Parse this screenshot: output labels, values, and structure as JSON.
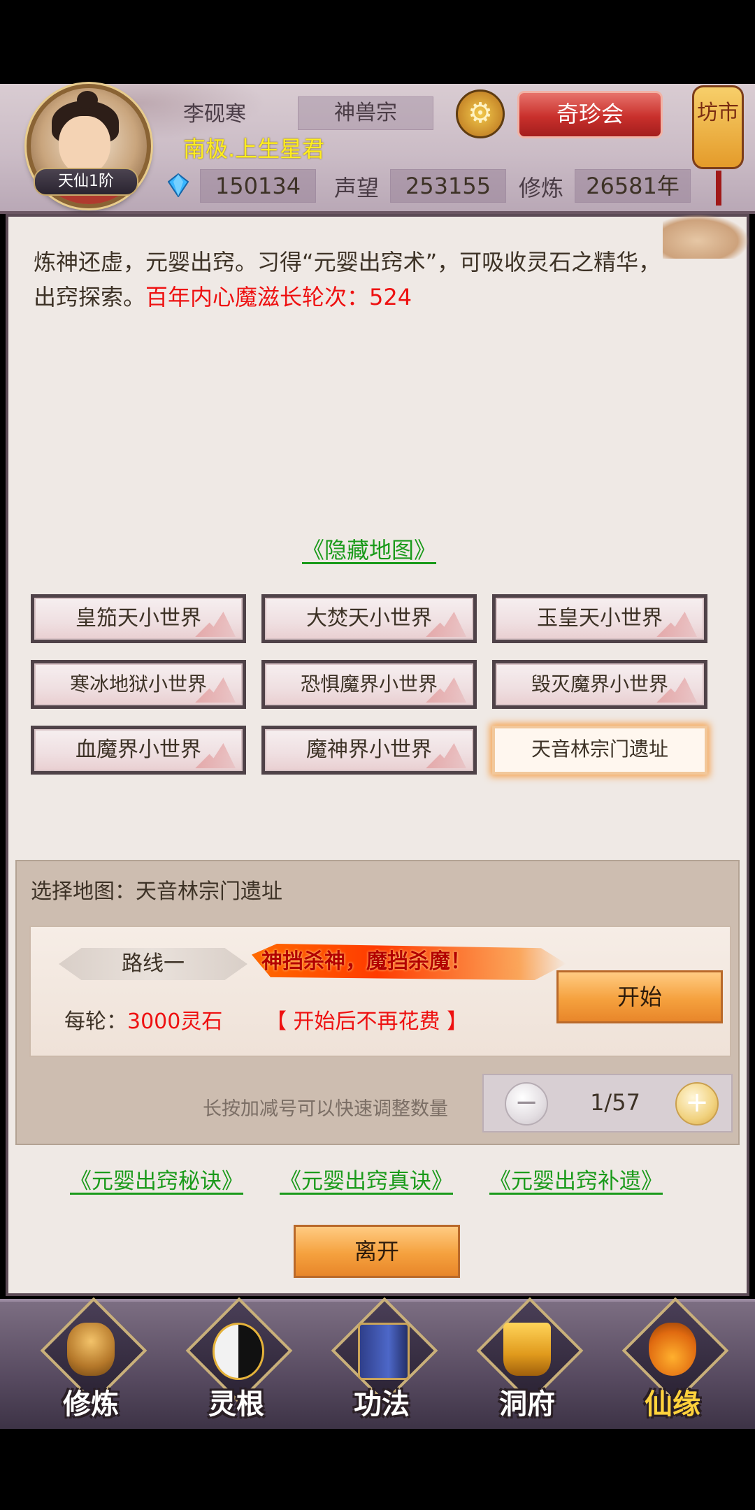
{
  "header": {
    "player_name": "李砚寒",
    "player_title": "南极.上生星君",
    "level": "天仙1阶",
    "sect": "神兽宗",
    "treasure_button": "奇珍会",
    "market_lantern": "坊市",
    "spirit_stones": "150134",
    "reputation_label": "声望",
    "reputation": "253155",
    "cultivation_label": "修炼",
    "cultivation": "26581年"
  },
  "main": {
    "description": "炼神还虚，元婴出窍。习得“元婴出窍术”，可吸收灵石之精华，出窍探索。",
    "description_highlight": "百年内心魔滋长轮次：524",
    "hidden_map_link": "《隐藏地图》",
    "maps": [
      {
        "label": "皇笳天小世界",
        "selected": false
      },
      {
        "label": "大焚天小世界",
        "selected": false
      },
      {
        "label": "玉皇天小世界",
        "selected": false
      },
      {
        "label": "寒冰地狱小世界",
        "selected": false
      },
      {
        "label": "恐惧魔界小世界",
        "selected": false
      },
      {
        "label": "毁灭魔界小世界",
        "selected": false
      },
      {
        "label": "血魔界小世界",
        "selected": false
      },
      {
        "label": "魔神界小世界",
        "selected": false
      },
      {
        "label": "天音林宗门遗址",
        "selected": true
      }
    ],
    "selection": {
      "label": "选择地图：天音林宗门遗址",
      "route_name": "路线一",
      "route_slogan": "神挡杀神，魔挡杀魔！",
      "per_round_label": "每轮：",
      "per_round_cost": "3000灵石",
      "no_cost_note": "【 开始后不再花费 】",
      "start_button": "开始",
      "hint": "长按加减号可以快速调整数量",
      "stepper_value": "1/57",
      "minus": "−",
      "plus": "+"
    },
    "technique_links": [
      "《元婴出窍秘诀》",
      "《元婴出窍真诀》",
      "《元婴出窍补遗》"
    ],
    "leave_button": "离开"
  },
  "bottom_nav": [
    {
      "label": "修炼",
      "icon": "monk-icon",
      "active": false
    },
    {
      "label": "灵根",
      "icon": "yinyang-sword-icon",
      "active": false
    },
    {
      "label": "功法",
      "icon": "book-icon",
      "active": false
    },
    {
      "label": "洞府",
      "icon": "pagoda-icon",
      "active": false
    },
    {
      "label": "仙缘",
      "icon": "gourd-icon",
      "active": true
    }
  ],
  "colors": {
    "highlight_red": "#ee1111",
    "link_green": "#1a9a1a",
    "title_yellow": "#ffee1e",
    "button_orange": "#f5a13e",
    "header_lavender": "#cbbcc6"
  }
}
